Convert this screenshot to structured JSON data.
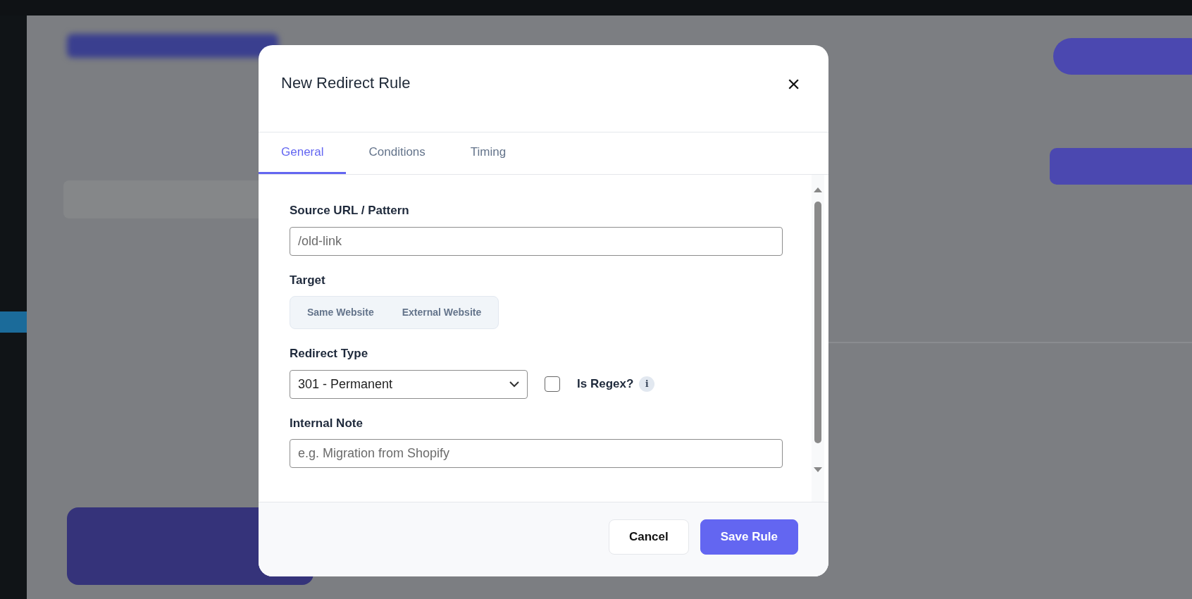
{
  "modal": {
    "title": "New Redirect Rule",
    "close": "×",
    "tabs": [
      {
        "label": "General",
        "selected": true
      },
      {
        "label": "Conditions",
        "selected": false
      },
      {
        "label": "Timing",
        "selected": false
      }
    ],
    "source": {
      "label": "Source URL / Pattern",
      "placeholder": "/old-link"
    },
    "target": {
      "label": "Target",
      "options": [
        {
          "label": "Same Website",
          "selected": false
        },
        {
          "label": "External Website",
          "selected": false
        }
      ]
    },
    "redirect_type": {
      "label": "Redirect Type",
      "value": "301 - Permanent"
    },
    "is_regex": {
      "label": "Is Regex?",
      "checked": false,
      "info": "i"
    },
    "note": {
      "label": "Internal Note",
      "placeholder": "e.g. Migration from Shopify"
    },
    "buttons": [
      {
        "label": "Cancel",
        "kind": "secondary"
      },
      {
        "label": "Save Rule",
        "kind": "primary"
      }
    ]
  }
}
